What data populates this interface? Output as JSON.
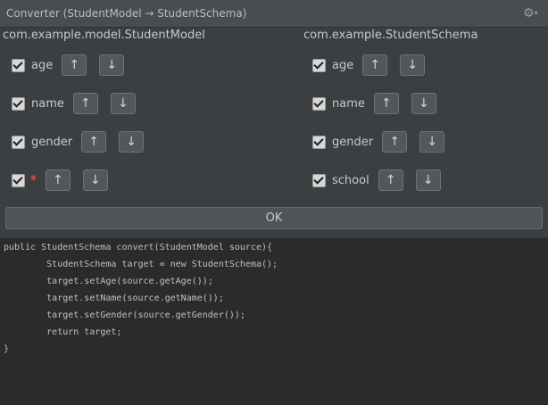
{
  "window": {
    "title": "Converter (StudentModel → StudentSchema)",
    "gear_icon": "gear-icon"
  },
  "left": {
    "class_name": "com.example.model.StudentModel",
    "fields": [
      {
        "label": "age",
        "checked": true
      },
      {
        "label": "name",
        "checked": true
      },
      {
        "label": "gender",
        "checked": true
      },
      {
        "label": "*",
        "checked": true
      }
    ]
  },
  "right": {
    "class_name": "com.example.StudentSchema",
    "fields": [
      {
        "label": "age",
        "checked": true
      },
      {
        "label": "name",
        "checked": true
      },
      {
        "label": "gender",
        "checked": true
      },
      {
        "label": "school",
        "checked": true
      }
    ]
  },
  "buttons": {
    "up": "↑",
    "down": "↓",
    "ok": "OK"
  },
  "code": [
    "public StudentSchema convert(StudentModel source){",
    "        StudentSchema target = new StudentSchema();",
    "        target.setAge(source.getAge());",
    "        target.setName(source.getName());",
    "        target.setGender(source.getGender());",
    "        return target;",
    "}"
  ]
}
